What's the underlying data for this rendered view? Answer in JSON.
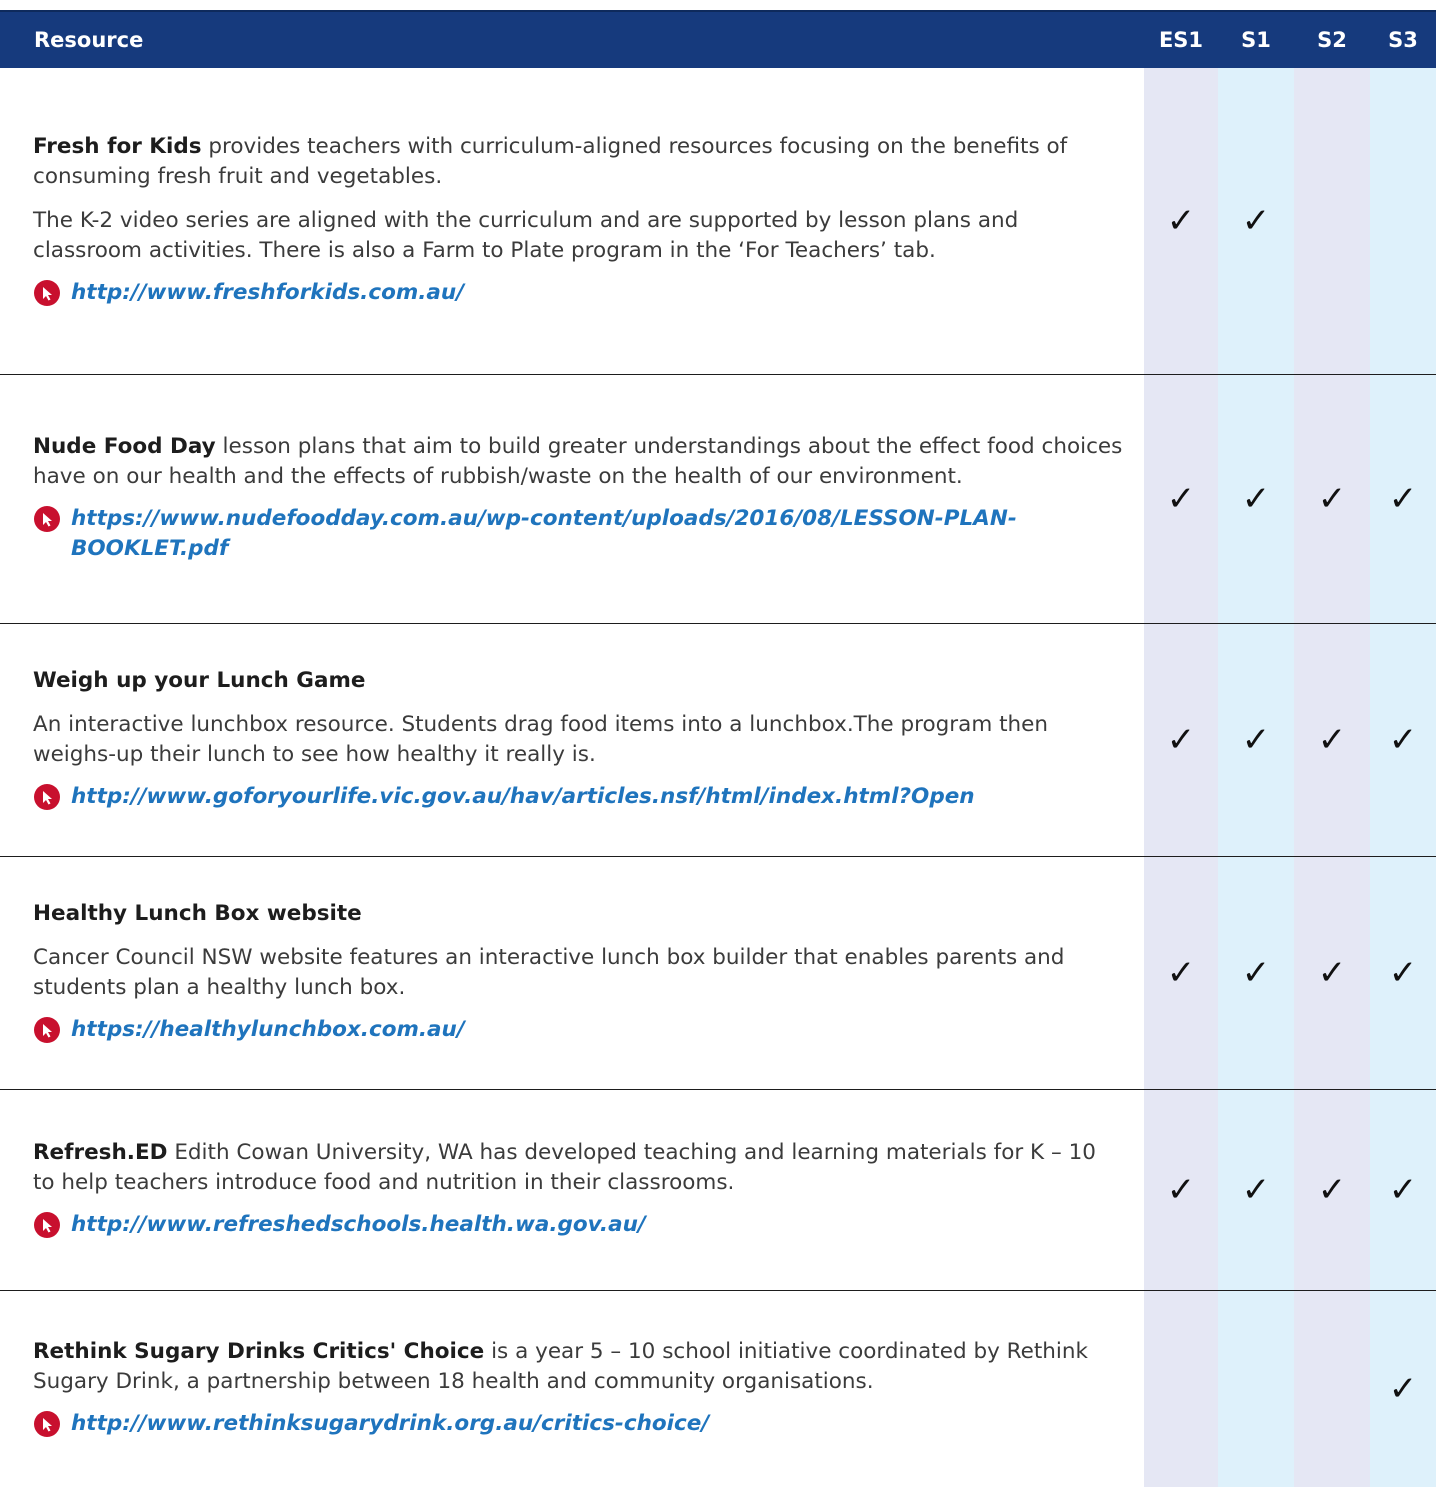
{
  "header": {
    "resource": "Resource",
    "es1": "ES1",
    "s1": "S1",
    "s2": "S2",
    "s3": "S3"
  },
  "check_mark": "✓",
  "colors": {
    "header_bg": "#163a7d",
    "link": "#1f74bd",
    "icon": "#c8102e",
    "es1_s2_band": "#e5e7f4",
    "s1_s3_band": "#def1fb"
  },
  "rows": [
    {
      "title": "Fresh for Kids",
      "p1": " provides teachers with curriculum-aligned resources focusing on the benefits of consuming fresh fruit and vegetables.",
      "p2": "The K-2 video series are aligned with the curriculum and are supported by lesson plans and classroom activities. There is also a Farm to Plate program in the ‘For Teachers’ tab.",
      "link": "http://www.freshforkids.com.au/",
      "es1": "✓",
      "s1": "✓",
      "s2": "",
      "s3": ""
    },
    {
      "title": "Nude Food Day",
      "p1": " lesson plans that aim to build greater understandings about the effect food choices have on our health and the effects of rubbish/waste on the health of our environment.",
      "link": "https://www.nudefoodday.com.au/wp-content/uploads/2016/08/LESSON-PLAN-BOOKLET.pdf",
      "es1": "✓",
      "s1": "✓",
      "s2": "✓",
      "s3": "✓"
    },
    {
      "title": "Weigh up your Lunch Game",
      "p1": "An interactive lunchbox resource. Students drag food items into a lunchbox.The  program then weighs-up their lunch to see how healthy it really is.",
      "link": "http://www.goforyourlife.vic.gov.au/hav/articles.nsf/html/index.html?Open",
      "es1": "✓",
      "s1": "✓",
      "s2": "✓",
      "s3": "✓"
    },
    {
      "title": "Healthy Lunch Box website",
      "p1": "Cancer Council NSW website features an interactive lunch box builder that enables parents and students plan a healthy lunch box.",
      "link": "https://healthylunchbox.com.au/",
      "es1": "✓",
      "s1": "✓",
      "s2": "✓",
      "s3": "✓"
    },
    {
      "title": "Refresh.ED",
      "p1": " Edith Cowan University, WA  has developed teaching and learning materials for K – 10 to help teachers introduce food and nutrition in their classrooms.",
      "link": "http://www.refreshedschools.health.wa.gov.au/",
      "es1": "✓",
      "s1": "✓",
      "s2": "✓",
      "s3": "✓"
    },
    {
      "title": "Rethink Sugary Drinks Critics' Choice",
      "p1": " is a year  5 – 10 school initiative coordinated by Rethink Sugary Drink, a partnership between 18 health and community organisations.",
      "link": "http://www.rethinksugarydrink.org.au/critics-choice/",
      "es1": "",
      "s1": "",
      "s2": "",
      "s3": "✓"
    }
  ]
}
